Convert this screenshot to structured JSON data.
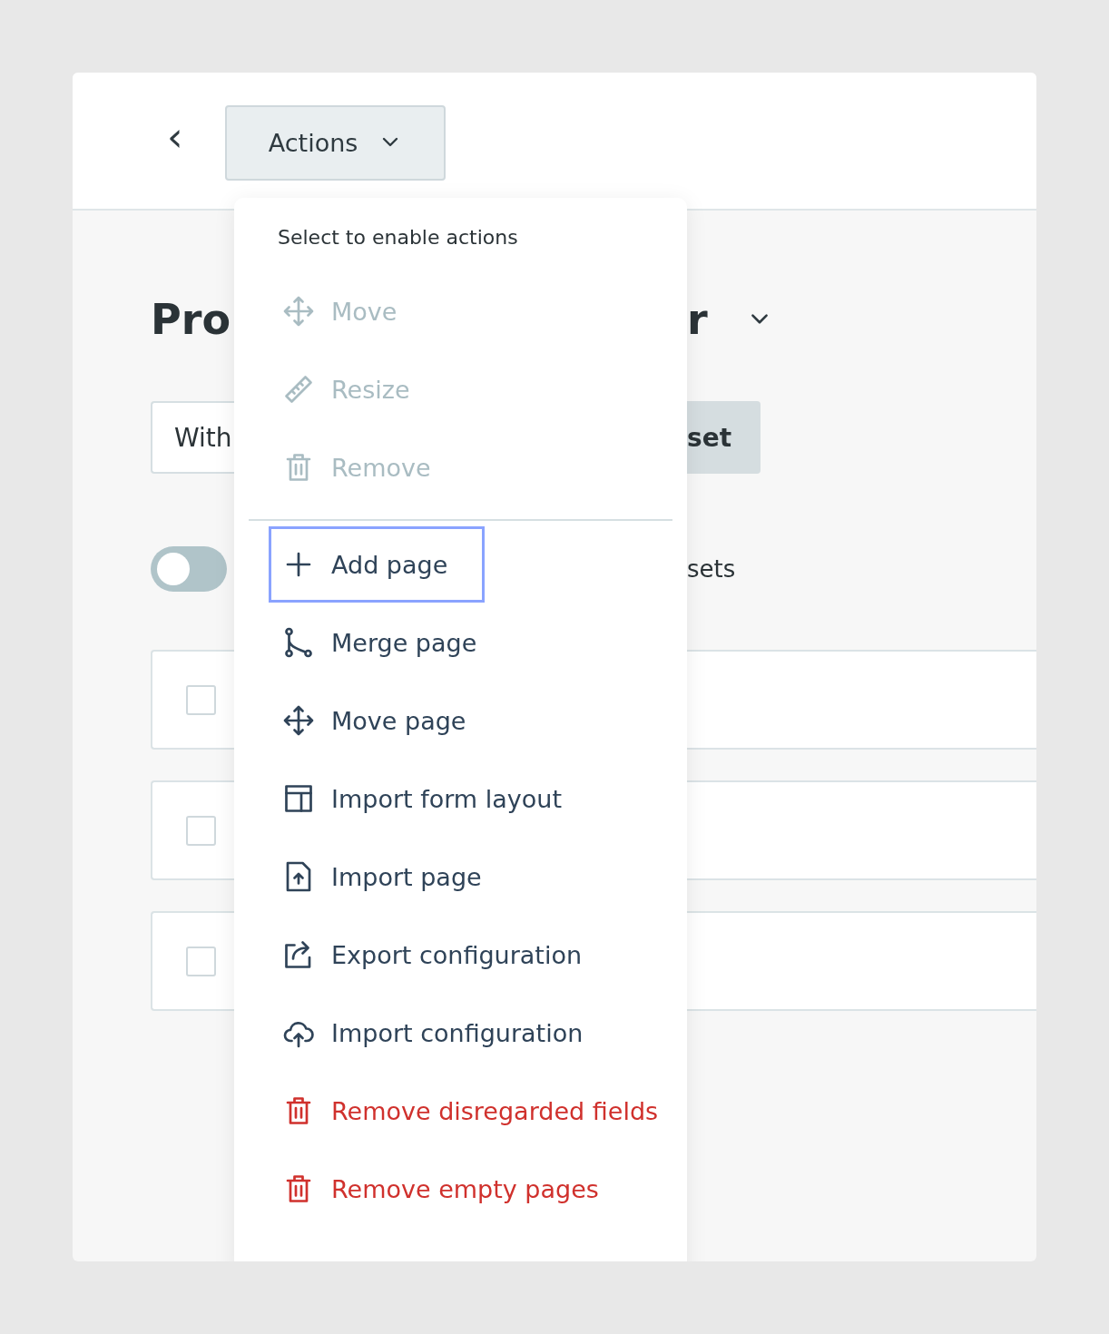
{
  "header": {
    "back": "‹",
    "actions_button": {
      "label": "Actions",
      "expanded": true
    }
  },
  "page": {
    "title_start": "Pro",
    "title_end": "r",
    "filter": {
      "value": "With",
      "button": "set"
    },
    "toggle": {
      "on": false,
      "label": "sets"
    },
    "rows": [
      {
        "checked": false
      },
      {
        "checked": false
      },
      {
        "checked": false
      }
    ]
  },
  "menu": {
    "hint": "Select to enable actions",
    "sections": [
      {
        "items": [
          {
            "label": "Move",
            "disabled": true,
            "danger": false,
            "focused": false
          },
          {
            "label": "Resize",
            "disabled": true,
            "danger": false,
            "focused": false
          },
          {
            "label": "Remove",
            "disabled": true,
            "danger": false,
            "focused": false
          }
        ]
      },
      {
        "items": [
          {
            "label": "Add page",
            "disabled": false,
            "danger": false,
            "focused": true
          },
          {
            "label": "Merge page",
            "disabled": false,
            "danger": false,
            "focused": false
          },
          {
            "label": "Move page",
            "disabled": false,
            "danger": false,
            "focused": false
          },
          {
            "label": "Import form layout",
            "disabled": false,
            "danger": false,
            "focused": false
          },
          {
            "label": "Import page",
            "disabled": false,
            "danger": false,
            "focused": false
          },
          {
            "label": "Export configuration",
            "disabled": false,
            "danger": false,
            "focused": false
          },
          {
            "label": "Import configuration",
            "disabled": false,
            "danger": false,
            "focused": false
          },
          {
            "label": "Remove disregarded fields",
            "disabled": false,
            "danger": true,
            "focused": false
          },
          {
            "label": "Remove empty pages",
            "disabled": false,
            "danger": true,
            "focused": false
          }
        ]
      }
    ]
  }
}
